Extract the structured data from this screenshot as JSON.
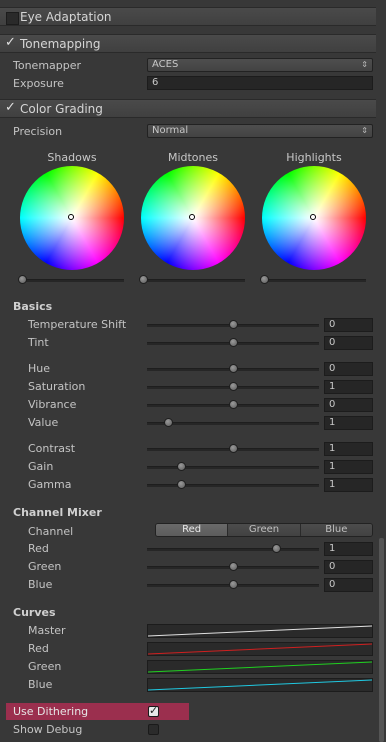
{
  "sections": {
    "eye_adaptation": {
      "title": "Eye Adaptation",
      "enabled": false
    },
    "tonemapping": {
      "title": "Tonemapping",
      "enabled": true,
      "check_glyph": "✓"
    },
    "color_grading": {
      "title": "Color Grading",
      "enabled": true,
      "check_glyph": "✓"
    }
  },
  "tonemapping": {
    "tonemapper_label": "Tonemapper",
    "tonemapper_value": "ACES",
    "exposure_label": "Exposure",
    "exposure_value": "6"
  },
  "color_grading": {
    "precision_label": "Precision",
    "precision_value": "Normal",
    "wheels": [
      {
        "label": "Shadows"
      },
      {
        "label": "Midtones"
      },
      {
        "label": "Highlights"
      }
    ]
  },
  "basics": {
    "header": "Basics",
    "temperature_label": "Temperature Shift",
    "temperature_value": "0",
    "temperature_level": 0.5,
    "tint_label": "Tint",
    "tint_value": "0",
    "tint_level": 0.5,
    "hue_label": "Hue",
    "hue_value": "0",
    "hue_level": 0.5,
    "saturation_label": "Saturation",
    "saturation_value": "1",
    "saturation_level": 0.5,
    "vibrance_label": "Vibrance",
    "vibrance_value": "0",
    "vibrance_level": 0.5,
    "value_label": "Value",
    "value_value": "1",
    "value_level": 0.12,
    "contrast_label": "Contrast",
    "contrast_value": "1",
    "contrast_level": 0.5,
    "gain_label": "Gain",
    "gain_value": "1",
    "gain_level": 0.2,
    "gamma_label": "Gamma",
    "gamma_value": "1",
    "gamma_level": 0.2
  },
  "channel_mixer": {
    "header": "Channel Mixer",
    "channel_label": "Channel",
    "channels": [
      "Red",
      "Green",
      "Blue"
    ],
    "selected_channel": "Red",
    "red_label": "Red",
    "red_value": "1",
    "red_level": 0.75,
    "green_label": "Green",
    "green_value": "0",
    "green_level": 0.5,
    "blue_label": "Blue",
    "blue_value": "0",
    "blue_level": 0.5
  },
  "curves": {
    "header": "Curves",
    "master_label": "Master",
    "master_color": "#e0e0e0",
    "red_label": "Red",
    "red_color": "#d02020",
    "green_label": "Green",
    "green_color": "#20d020",
    "blue_label": "Blue",
    "blue_color": "#20c8e0"
  },
  "options": {
    "use_dithering_label": "Use Dithering",
    "use_dithering_checked": true,
    "show_debug_label": "Show Debug",
    "show_debug_checked": false,
    "check_glyph": "✓"
  },
  "colors": {
    "highlight": "#9b2f4e",
    "panel_bg": "#383838"
  }
}
